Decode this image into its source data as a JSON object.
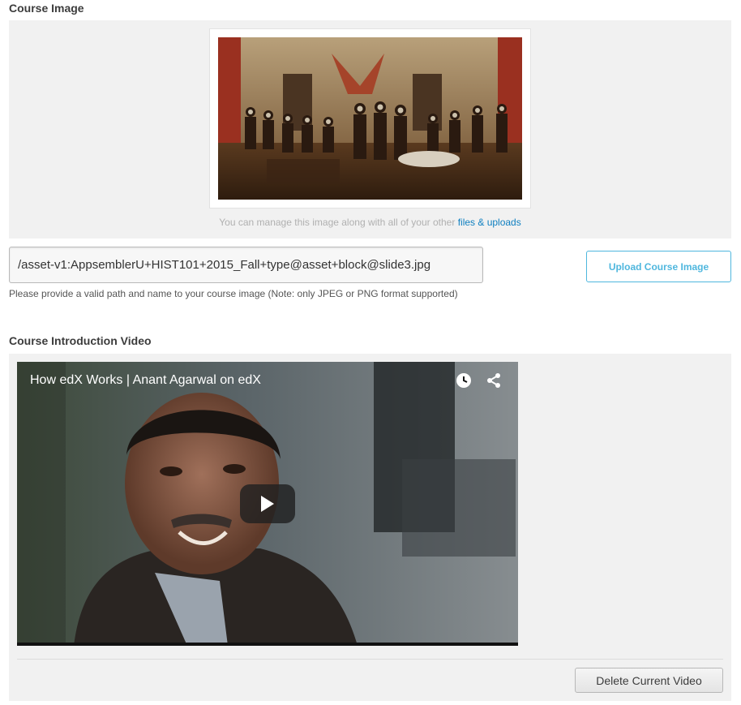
{
  "course_image": {
    "section_label": "Course Image",
    "manage_note_prefix": "You can manage this image along with all of your other",
    "manage_link": "files & uploads",
    "path_value": "/asset-v1:AppsemblerU+HIST101+2015_Fall+type@asset+block@slide3.jpg",
    "upload_button": "Upload Course Image",
    "help_text": "Please provide a valid path and name to your course image (Note: only JPEG or PNG format supported)"
  },
  "course_video": {
    "section_label": "Course Introduction Video",
    "video_title": "How edX Works | Anant Agarwal on edX",
    "delete_button": "Delete Current Video"
  },
  "icons": {
    "clock": "clock-icon",
    "share": "share-icon",
    "play": "play-icon"
  },
  "colors": {
    "link": "#0e7fc0",
    "upload_accent": "#4fb7de",
    "panel_bg": "#f1f1f1"
  }
}
